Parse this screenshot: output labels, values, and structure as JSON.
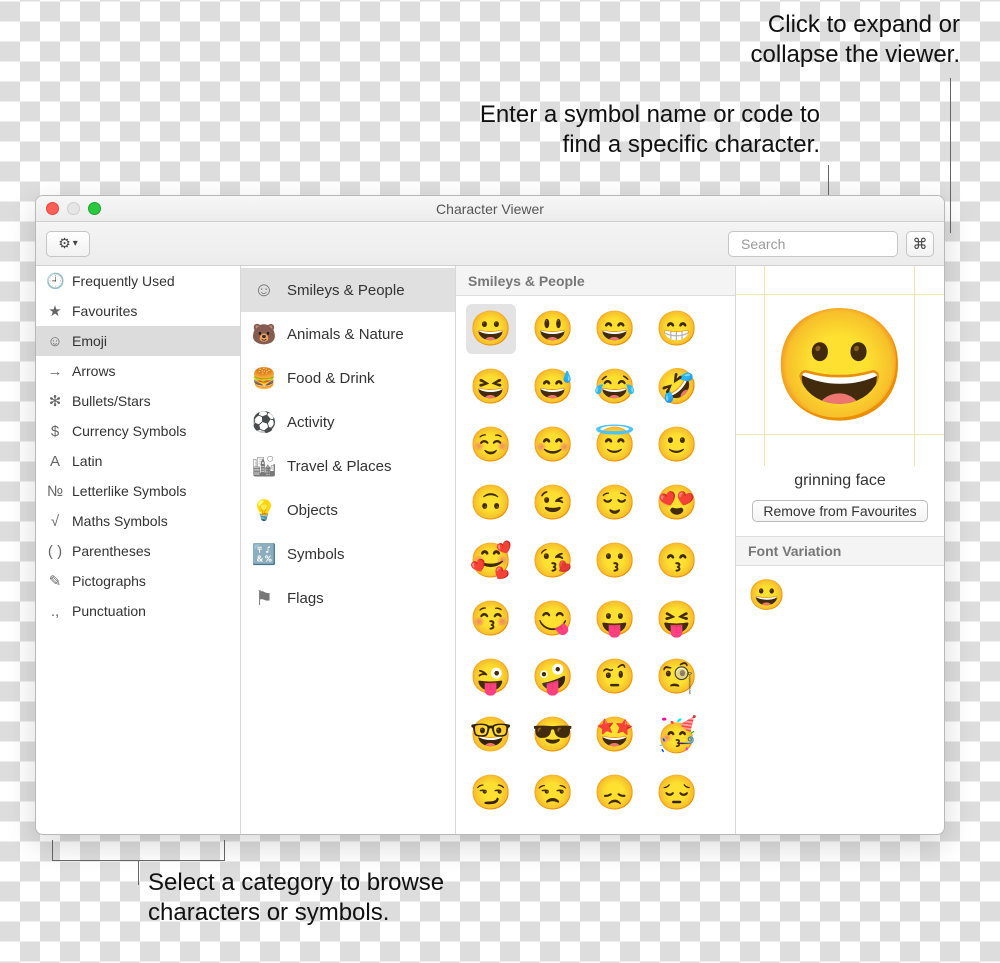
{
  "callouts": {
    "expand": "Click to expand or\ncollapse the viewer.",
    "search": "Enter a symbol name or code to\nfind a specific character.",
    "category": "Select a category to browse\ncharacters or symbols."
  },
  "window": {
    "title": "Character Viewer",
    "search_placeholder": "Search"
  },
  "sidebar": [
    {
      "icon": "🕘",
      "label": "Frequently Used"
    },
    {
      "icon": "★",
      "label": "Favourites"
    },
    {
      "icon": "☺",
      "label": "Emoji",
      "selected": true
    },
    {
      "icon": "→",
      "label": "Arrows"
    },
    {
      "icon": "✻",
      "label": "Bullets/Stars"
    },
    {
      "icon": "$",
      "label": "Currency Symbols"
    },
    {
      "icon": "A",
      "label": "Latin"
    },
    {
      "icon": "№",
      "label": "Letterlike Symbols"
    },
    {
      "icon": "√",
      "label": "Maths Symbols"
    },
    {
      "icon": "( )",
      "label": "Parentheses"
    },
    {
      "icon": "✎",
      "label": "Pictographs"
    },
    {
      "icon": ".,",
      "label": "Punctuation"
    }
  ],
  "subcategories": [
    {
      "icon": "☺",
      "label": "Smileys & People",
      "selected": true
    },
    {
      "icon": "🐻",
      "label": "Animals & Nature"
    },
    {
      "icon": "🍔",
      "label": "Food & Drink"
    },
    {
      "icon": "⚽",
      "label": "Activity"
    },
    {
      "icon": "🏙",
      "label": "Travel & Places"
    },
    {
      "icon": "💡",
      "label": "Objects"
    },
    {
      "icon": "🔣",
      "label": "Symbols"
    },
    {
      "icon": "⚑",
      "label": "Flags"
    }
  ],
  "grid": {
    "header": "Smileys & People",
    "emojis": [
      "😀",
      "😃",
      "😄",
      "😁",
      "😆",
      "😅",
      "😂",
      "🤣",
      "☺️",
      "😊",
      "😇",
      "🙂",
      "🙃",
      "😉",
      "😌",
      "😍",
      "🥰",
      "😘",
      "😗",
      "😙",
      "😚",
      "😋",
      "😛",
      "😝",
      "😜",
      "🤪",
      "🤨",
      "🧐",
      "🤓",
      "😎",
      "🤩",
      "🥳",
      "😏",
      "😒",
      "😞",
      "😔"
    ]
  },
  "detail": {
    "preview_emoji": "😀",
    "name": "grinning face",
    "fav_button": "Remove from Favourites",
    "font_variation_header": "Font Variation",
    "font_variation_emoji": "😀"
  }
}
